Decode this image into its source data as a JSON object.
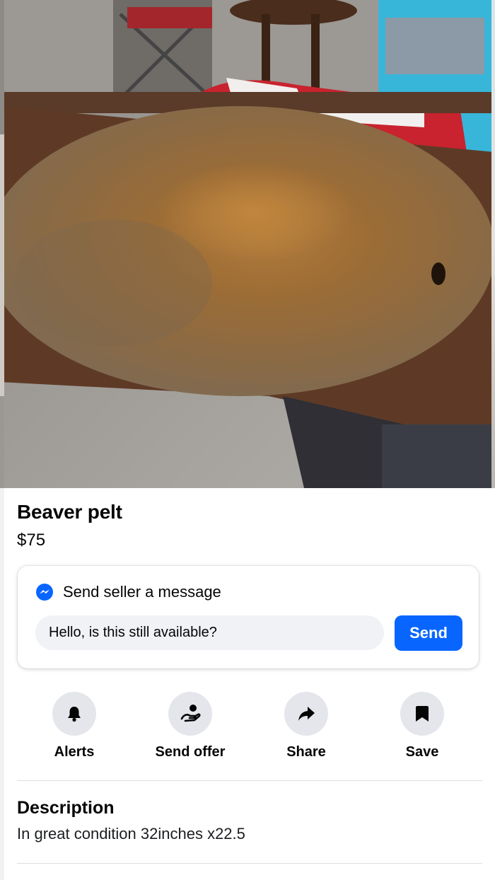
{
  "listing": {
    "title": "Beaver pelt",
    "price": "$75"
  },
  "photo": {
    "icon": "listing-photo-beaver-pelt"
  },
  "message_card": {
    "heading": "Send seller a message",
    "heading_icon": "messenger-icon",
    "input_value": "Hello, is this still available?",
    "send_label": "Send",
    "accent_color": "#0866ff"
  },
  "actions": [
    {
      "label": "Alerts",
      "icon": "bell-icon"
    },
    {
      "label": "Send offer",
      "icon": "send-offer-icon"
    },
    {
      "label": "Share",
      "icon": "share-arrow-icon"
    },
    {
      "label": "Save",
      "icon": "bookmark-icon"
    }
  ],
  "description": {
    "heading": "Description",
    "text": "In great condition 32inches x22.5"
  }
}
